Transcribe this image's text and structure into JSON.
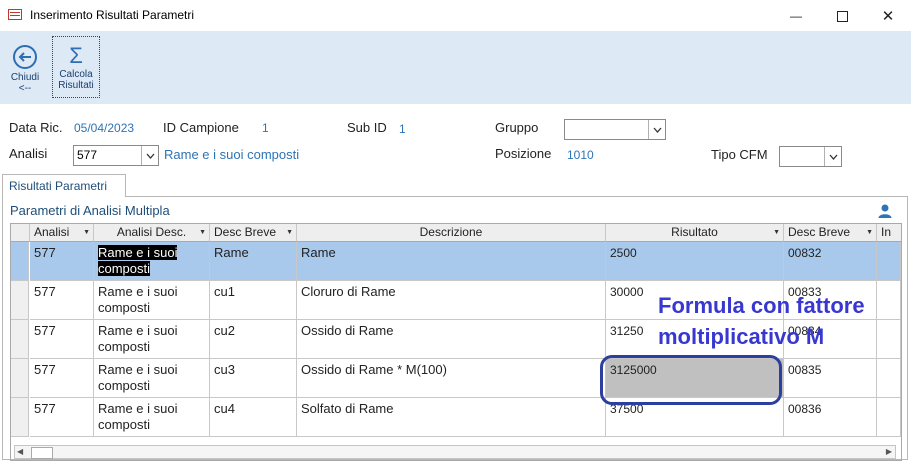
{
  "window": {
    "title": "Inserimento Risultati Parametri"
  },
  "ribbon": {
    "close_label_line1": "Chiudi",
    "close_label_line2": "<--",
    "calc_label_line1": "Calcola",
    "calc_label_line2": "Risultati"
  },
  "form": {
    "data_ric_label": "Data Ric.",
    "data_ric_value": "05/04/2023",
    "id_campione_label": "ID Campione",
    "id_campione_value": "1",
    "sub_id_label": "Sub ID",
    "sub_id_value": "1",
    "gruppo_label": "Gruppo",
    "gruppo_value": "",
    "analisi_label": "Analisi",
    "analisi_value": "577",
    "analisi_desc": "Rame e i suoi composti",
    "posizione_label": "Posizione",
    "posizione_value": "1010",
    "tipo_cfm_label": "Tipo CFM",
    "tipo_cfm_value": ""
  },
  "tabs": {
    "active": "Risultati Parametri"
  },
  "subform": {
    "title": "Parametri di Analisi Multipla"
  },
  "grid": {
    "columns": [
      "Analisi",
      "Analisi Desc.",
      "Desc Breve",
      "Descrizione",
      "Risultato",
      "Desc Breve",
      "In"
    ],
    "rows": [
      {
        "analisi": "577",
        "analisi_desc": "Rame e i suoi composti",
        "desc_breve": "Rame",
        "descrizione": "Rame",
        "risultato": "2500",
        "desc_breve2": "00832"
      },
      {
        "analisi": "577",
        "analisi_desc": "Rame e i suoi composti",
        "desc_breve": "cu1",
        "descrizione": "Cloruro di Rame",
        "risultato": "30000",
        "desc_breve2": "00833"
      },
      {
        "analisi": "577",
        "analisi_desc": "Rame e i suoi composti",
        "desc_breve": "cu2",
        "descrizione": "Ossido di Rame",
        "risultato": "31250",
        "desc_breve2": "00834"
      },
      {
        "analisi": "577",
        "analisi_desc": "Rame e i suoi composti",
        "desc_breve": "cu3",
        "descrizione": "Ossido di Rame * M(100)",
        "risultato": "3125000",
        "desc_breve2": "00835"
      },
      {
        "analisi": "577",
        "analisi_desc": "Rame e i suoi composti",
        "desc_breve": "cu4",
        "descrizione": "Solfato di Rame",
        "risultato": "37500",
        "desc_breve2": "00836"
      }
    ]
  },
  "annotation": {
    "line1": "Formula con fattore",
    "line2": "moltiplicativo M"
  },
  "colors": {
    "ribbon": "#dde9f5",
    "selected_row": "#a8c9ec",
    "value_text": "#2e74b5",
    "annotation": "#3838d0",
    "highlight_cell": "#c0c0c0"
  }
}
